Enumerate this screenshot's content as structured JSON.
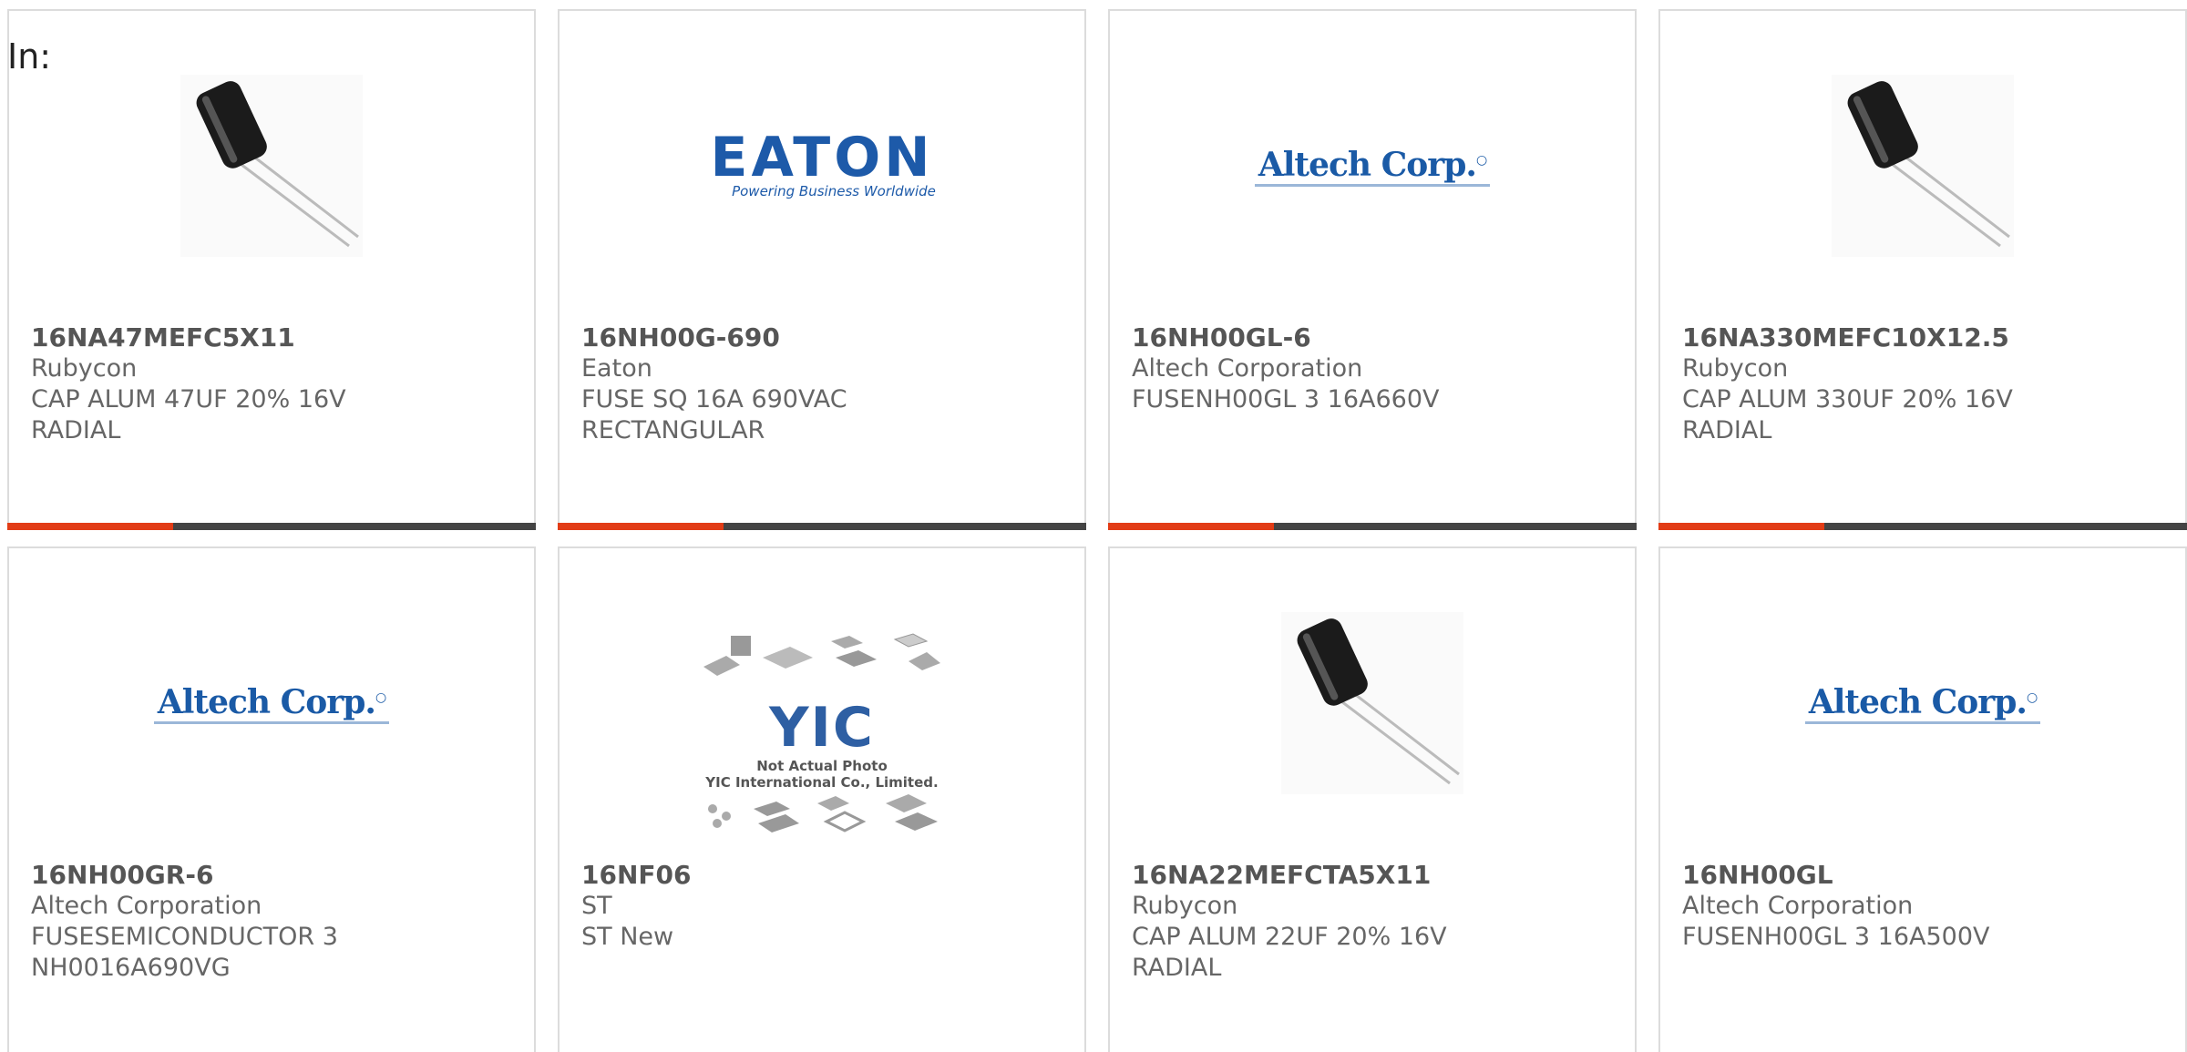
{
  "header": {
    "in_label": "In:"
  },
  "products": [
    {
      "part": "16NA47MEFC5X11",
      "maker": "Rubycon",
      "desc_line1": "CAP ALUM 47UF 20% 16V",
      "desc_line2": "RADIAL",
      "image": "capacitor-photo"
    },
    {
      "part": "16NH00G-690",
      "maker": "Eaton",
      "desc_line1": "FUSE SQ 16A 690VAC",
      "desc_line2": "RECTANGULAR",
      "image": "eaton-logo",
      "logo_text": "EATON",
      "logo_tagline": "Powering Business Worldwide"
    },
    {
      "part": "16NH00GL-6",
      "maker": "Altech Corporation",
      "desc_line1": "FUSENH00GL 3 16A660V",
      "desc_line2": "",
      "image": "altech-logo",
      "logo_text": "Altech Corp."
    },
    {
      "part": "16NA330MEFC10X12.5",
      "maker": "Rubycon",
      "desc_line1": "CAP ALUM 330UF 20% 16V",
      "desc_line2": "RADIAL",
      "image": "capacitor-photo"
    },
    {
      "part": "16NH00GR-6",
      "maker": "Altech Corporation",
      "desc_line1": "FUSESEMICONDUCTOR 3",
      "desc_line2": "NH0016A690VG",
      "image": "altech-logo",
      "logo_text": "Altech Corp."
    },
    {
      "part": "16NF06",
      "maker": "ST",
      "desc_line1": "ST New",
      "desc_line2": "",
      "image": "yic-placeholder",
      "logo_text": "YIC",
      "caption_line1": "Not Actual Photo",
      "caption_line2": "YIC International Co., Limited."
    },
    {
      "part": "16NA22MEFCTA5X11",
      "maker": "Rubycon",
      "desc_line1": "CAP ALUM 22UF 20% 16V",
      "desc_line2": "RADIAL",
      "image": "capacitor-photo"
    },
    {
      "part": "16NH00GL",
      "maker": "Altech Corporation",
      "desc_line1": "FUSENH00GL 3 16A500V",
      "desc_line2": "",
      "image": "altech-logo",
      "logo_text": "Altech Corp."
    }
  ],
  "colors": {
    "accent": "#e23c16",
    "bar": "#444444",
    "border": "#dcdcdc",
    "brand_blue": "#1d5aa9"
  }
}
